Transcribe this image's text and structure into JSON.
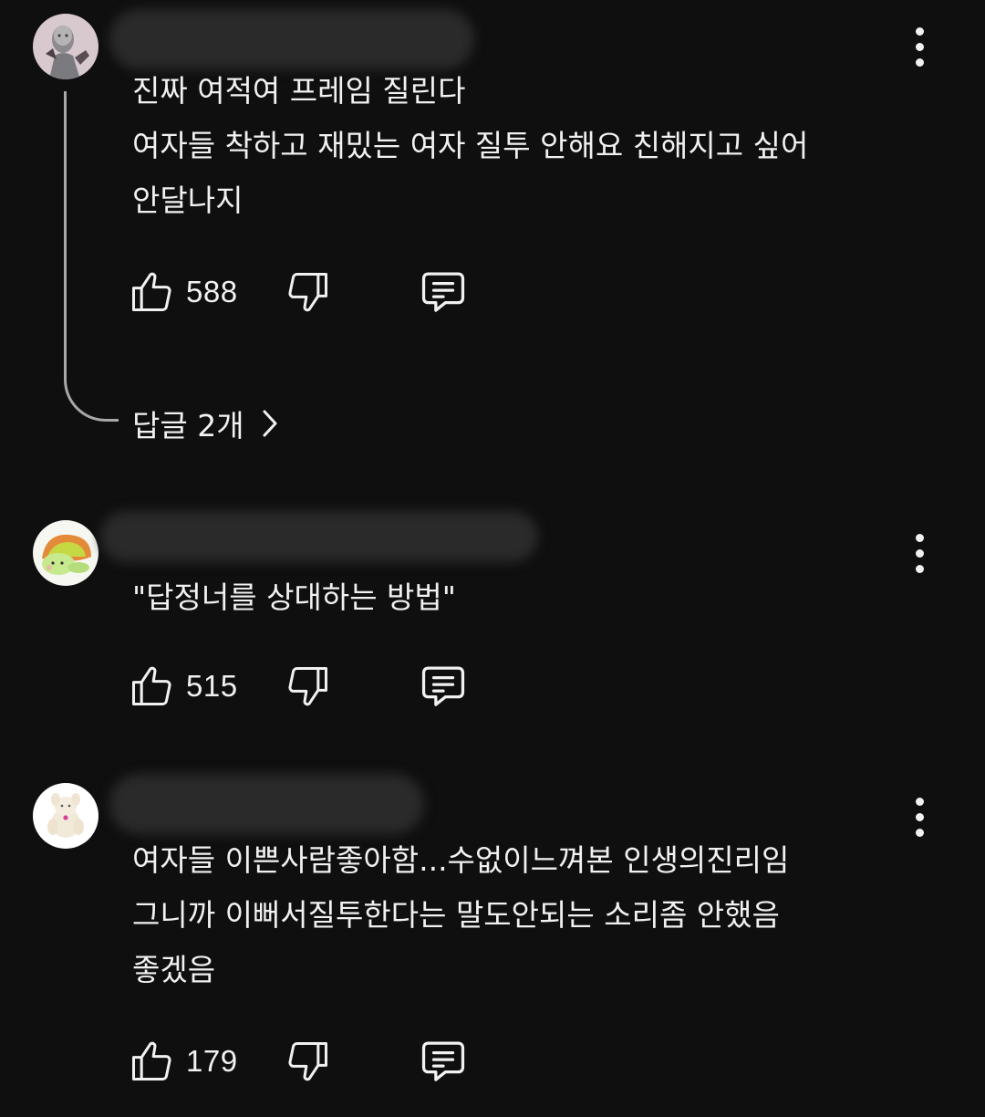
{
  "comments": [
    {
      "lines": [
        "진짜 여적여 프레임 질린다",
        "여자들 착하고 재밌는 여자 질투 안해요 친해지고 싶어",
        "안달나지"
      ],
      "likes": "588",
      "avatar_icon": "statue-avatar-icon"
    },
    {
      "lines": [
        "\"답정너를 상대하는 방법\""
      ],
      "likes": "515",
      "avatar_icon": "turtle-avatar-icon"
    },
    {
      "lines": [
        "여자들 이쁜사람좋아함...수없이느껴본 인생의진리임",
        "그니까 이뻐서질투한다는 말도안되는 소리좀 안했음",
        "좋겠음"
      ],
      "likes": "179",
      "avatar_icon": "plush-avatar-icon"
    }
  ],
  "replies_label": "답글 2개",
  "colors": {
    "background": "#0f0f0f",
    "text": "#f1f1f1",
    "thread_line": "#a8a8a8"
  }
}
